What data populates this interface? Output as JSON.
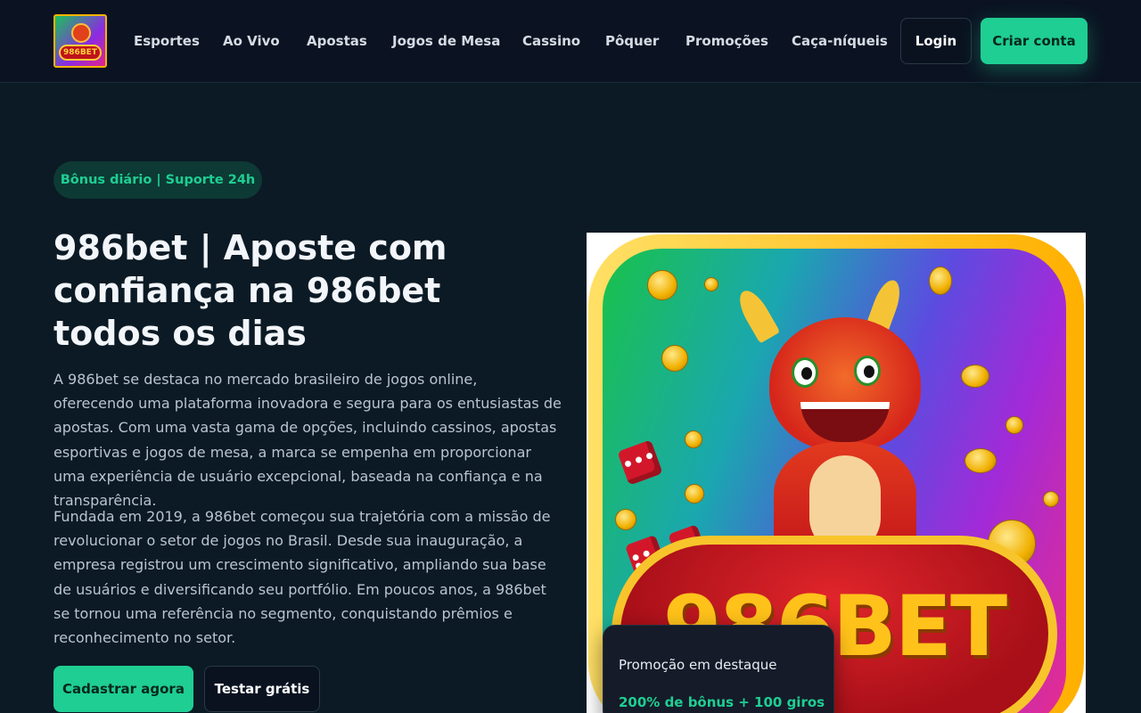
{
  "header": {
    "logo_text": "986BET",
    "nav": [
      "Esportes",
      "Ao Vivo",
      "Apostas",
      "Jogos de Mesa",
      "Cassino",
      "Pôquer",
      "Promoções",
      "Caça-níqueis"
    ],
    "login_label": "Login",
    "create_account_label": "Criar conta"
  },
  "hero": {
    "badge": "Bônus diário | Suporte 24h",
    "title": "986bet | Aposte com confiança na 986bet todos os dias",
    "paragraph1": "A 986bet se destaca no mercado brasileiro de jogos online, oferecendo uma plataforma inovadora e segura para os entusiastas de apostas. Com uma vasta gama de opções, incluindo cassinos, apostas esportivas e jogos de mesa, a marca se empenha em proporcionar uma experiência de usuário excepcional, baseada na confiança e na transparência.",
    "paragraph2": "Fundada em 2019, a 986bet começou sua trajetória com a missão de revolucionar o setor de jogos no Brasil. Desde sua inauguração, a empresa registrou um crescimento significativo, ampliando sua base de usuários e diversificando seu portfólio. Em poucos anos, a 986bet se tornou uma referência no segmento, conquistando prêmios e reconhecimento no setor.",
    "signup_label": "Cadastrar agora",
    "free_trial_label": "Testar grátis",
    "image_plaque_text": "986BET"
  },
  "promo": {
    "label": "Promoção em destaque",
    "value": "200% de bônus + 100 giros"
  },
  "colors": {
    "accent": "#1fce93",
    "background": "#0b1a24",
    "header_bg": "#0b1322"
  }
}
